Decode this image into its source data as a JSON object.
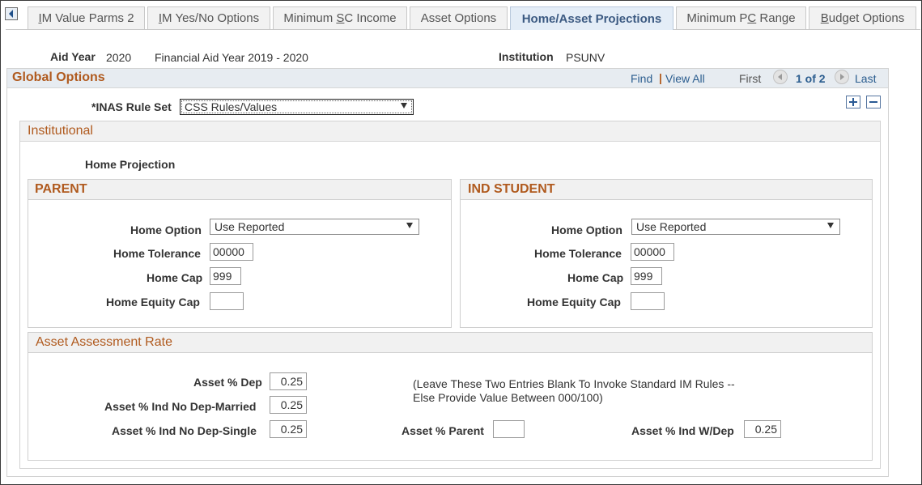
{
  "tabs": [
    {
      "label": "IM Value Parms 2",
      "accel": "I",
      "rest": "M Value Parms 2",
      "active": false
    },
    {
      "label": "IM Yes/No Options",
      "accel": "I",
      "rest": "M Yes/No Options",
      "active": false
    },
    {
      "label_pre": "Minimum ",
      "accel": "S",
      "label_post": "C Income",
      "label": "Minimum SC Income",
      "active": false
    },
    {
      "label": "Asset Options",
      "active": false
    },
    {
      "label": "Home/Asset Projections",
      "active": true
    },
    {
      "label_pre": "Minimum P",
      "accel": "C",
      "label_post": " Range",
      "label": "Minimum PC Range",
      "active": false
    },
    {
      "label": "Budget Options",
      "accel": "B",
      "rest": "udget Options",
      "active": false
    }
  ],
  "header": {
    "aid_year_label": "Aid Year",
    "aid_year_value": "2020",
    "aid_year_desc": "Financial Aid Year 2019 - 2020",
    "institution_label": "Institution",
    "institution_value": "PSUNV"
  },
  "global_options": {
    "title": "Global Options",
    "find_link": "Find",
    "separator": "|",
    "view_all_link": "View All",
    "first_label": "First",
    "count": "1 of 2",
    "last_label": "Last",
    "inas_rule_set_label": "*INAS Rule Set",
    "inas_rule_set_value": "CSS Rules/Values"
  },
  "institutional": {
    "title": "Institutional",
    "home_projection_label": "Home Projection",
    "parent": {
      "title": "PARENT",
      "home_option_label": "Home Option",
      "home_option_value": "Use Reported",
      "home_tolerance_label": "Home Tolerance",
      "home_tolerance_value": "00000",
      "home_cap_label": "Home Cap",
      "home_cap_value": "999",
      "home_equity_cap_label": "Home Equity Cap",
      "home_equity_cap_value": ""
    },
    "ind_student": {
      "title": "IND STUDENT",
      "home_option_label": "Home Option",
      "home_option_value": "Use Reported",
      "home_tolerance_label": "Home Tolerance",
      "home_tolerance_value": "00000",
      "home_cap_label": "Home Cap",
      "home_cap_value": "999",
      "home_equity_cap_label": "Home Equity Cap",
      "home_equity_cap_value": ""
    },
    "asset_assessment": {
      "title": "Asset Assessment Rate",
      "asset_dep_label": "Asset % Dep",
      "asset_dep_value": "0.25",
      "asset_ind_married_label": "Asset % Ind No Dep-Married",
      "asset_ind_married_value": "0.25",
      "asset_ind_single_label": "Asset % Ind No Dep-Single",
      "asset_ind_single_value": "0.25",
      "note_line1": "(Leave These Two Entries Blank To Invoke Standard IM Rules --",
      "note_line2": "Else Provide Value Between 000/100)",
      "asset_parent_label": "Asset % Parent",
      "asset_parent_value": "",
      "asset_ind_wdep_label": "Asset % Ind W/Dep",
      "asset_ind_wdep_value": "0.25"
    }
  },
  "colors": {
    "section_title": "#b05a1e",
    "link": "#2b5d8f",
    "active_tab_bg": "#e4edf7"
  }
}
